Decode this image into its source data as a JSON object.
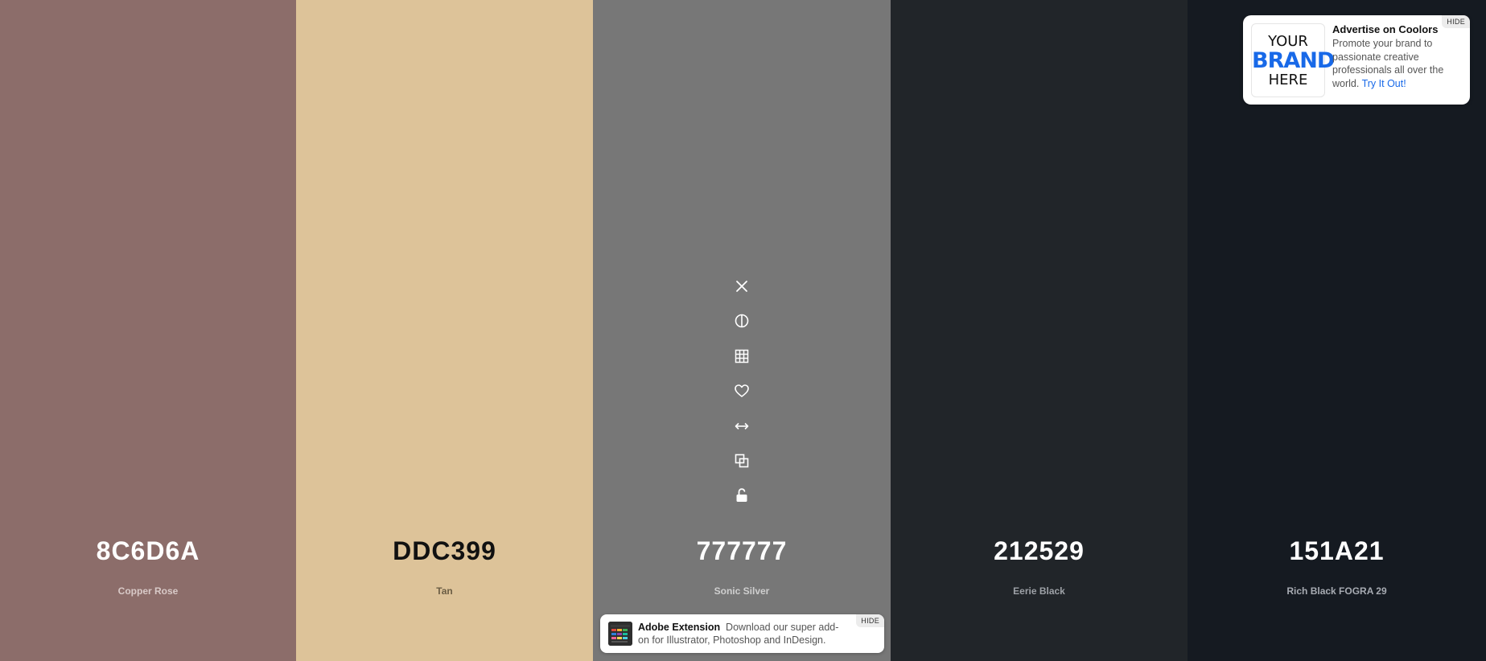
{
  "swatches": [
    {
      "hex": "8C6D6A",
      "name": "Copper Rose",
      "bg": "#8C6D6A",
      "text_color": "#ffffff",
      "name_color": "#d9cac8"
    },
    {
      "hex": "DDC399",
      "name": "Tan",
      "bg": "#DDC399",
      "text_color": "#111111",
      "name_color": "#6b5d44"
    },
    {
      "hex": "777777",
      "name": "Sonic Silver",
      "bg": "#777777",
      "text_color": "#ffffff",
      "name_color": "#cfcfcf"
    },
    {
      "hex": "212529",
      "name": "Eerie Black",
      "bg": "#212529",
      "text_color": "#ffffff",
      "name_color": "#9da1a6"
    },
    {
      "hex": "151A21",
      "name": "Rich Black FOGRA 29",
      "bg": "#151A21",
      "text_color": "#ffffff",
      "name_color": "#a7abb2"
    }
  ],
  "toolbar": {
    "icons": [
      "close-icon",
      "contrast-icon",
      "shades-grid-icon",
      "heart-icon",
      "drag-arrows-icon",
      "copy-icon",
      "unlock-icon"
    ]
  },
  "ad": {
    "logo_line1": "YOUR",
    "logo_line2": "BRAND",
    "logo_line3": "HERE",
    "title": "Advertise on Coolors",
    "text": "Promote your brand to passionate creative professionals all over the world.",
    "link": "Try It Out!",
    "hide": "HIDE"
  },
  "bottom_banner": {
    "title": "Adobe Extension",
    "text": "Download our super add-on for Illustrator, Photoshop and InDesign.",
    "hide": "HIDE"
  }
}
